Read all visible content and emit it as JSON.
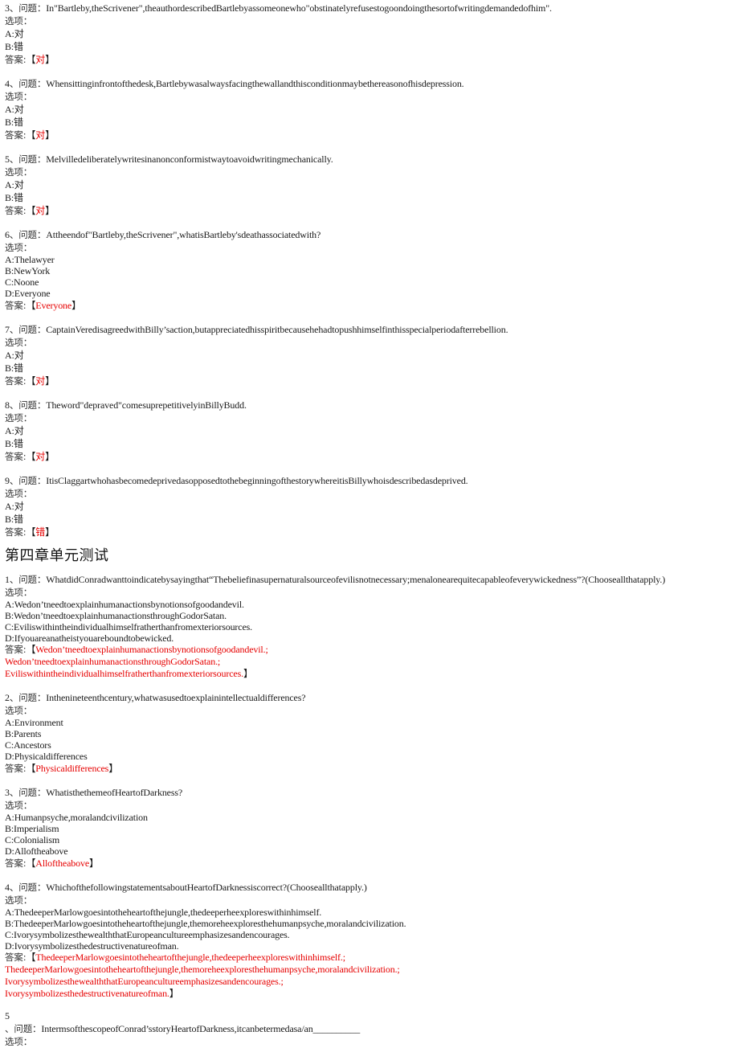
{
  "labels": {
    "question_prefix": "、问题：",
    "options_label": "选项：",
    "answer_label": "答案:",
    "bracket_open": "【",
    "bracket_close": "】"
  },
  "part1": [
    {
      "number": "3",
      "question": "In\"Bartleby,theScrivener\",theauthordescribedBartlebyassomeonewho\"obstinatelyrefusestogoondoingthesortofwritingdemandedofhim\".",
      "options": [
        "A:对",
        "B:错"
      ],
      "answer": "对"
    },
    {
      "number": "4",
      "question": "Whensittinginfrontofthedesk,Bartlebywasalwaysfacingthewallandthisconditionmaybethereasonofhisdepression.",
      "options": [
        "A:对",
        "B:错"
      ],
      "answer": "对"
    },
    {
      "number": "5",
      "question": "Melvilledeliberatelywritesinanonconformistwaytoavoidwritingmechanically.",
      "options": [
        "A:对",
        "B:错"
      ],
      "answer": "对"
    },
    {
      "number": "6",
      "question": "Attheendof\"Bartleby,theScrivener\",whatisBartleby'sdeathassociatedwith?",
      "options": [
        "A:Thelawyer",
        "B:NewYork",
        "C:Noone",
        "D:Everyone"
      ],
      "answer": "Everyone"
    },
    {
      "number": "7",
      "question": "CaptainVeredisagreedwithBilly’saction,butappreciatedhisspiritbecausehehadtopushhimselfinthisspecialperiodafterrebellion.",
      "options": [
        "A:对",
        "B:错"
      ],
      "answer": "对"
    },
    {
      "number": "8",
      "question": "Theword\"depraved\"comesuprepetitivelyinBillyBudd.",
      "options": [
        "A:对",
        "B:错"
      ],
      "answer": "对"
    },
    {
      "number": "9",
      "question": "ItisClaggartwhohasbecomedeprivedasopposedtothebeginningofthestorywhereitisBillywhoisdescribedasdeprived.",
      "options": [
        "A:对",
        "B:错"
      ],
      "answer": "错"
    }
  ],
  "section_title": "第四章单元测试",
  "part2": [
    {
      "number": "1",
      "question": "WhatdidConradwanttoindicatebysayingthat“Thebeliefinasupernaturalsourceofevilisnotnecessary;menalonearequitecapableofeverywickedness”?(Chooseallthatapply.)",
      "options": [
        "A:Wedon’tneedtoexplainhumanactionsbynotionsofgoodandevil.",
        "B:Wedon’tneedtoexplainhumanactionsthroughGodorSatan.",
        "C:Eviliswithintheindividualhimselfratherthanfromexteriorsources.",
        "D:Ifyouareanatheistyouareboundtobewicked."
      ],
      "answer_lines": [
        "Wedon’tneedtoexplainhumanactionsbynotionsofgoodandevil.;",
        "Wedon’tneedtoexplainhumanactionsthroughGodorSatan.;",
        "Eviliswithintheindividualhimselfratherthanfromexteriorsources."
      ]
    },
    {
      "number": "2",
      "question": "Inthenineteenthcentury,whatwasusedtoexplainintellectualdifferences?",
      "options": [
        "A:Environment",
        "B:Parents",
        "C:Ancestors",
        "D:Physicaldifferences"
      ],
      "answer": "Physicaldifferences"
    },
    {
      "number": "3",
      "question": "WhatisthethemeofHeartofDarkness?",
      "options": [
        "A:Humanpsyche,moralandcivilization",
        "B:Imperialism",
        "C:Colonialism",
        "D:Alloftheabove"
      ],
      "answer": "Alloftheabove"
    },
    {
      "number": "4",
      "question": "WhichofthefollowingstatementsaboutHeartofDarknessiscorrect?(Chooseallthatapply.)",
      "options": [
        "A:ThedeeperMarlowgoesintotheheartofthejungle,thedeeperheexploreswithinhimself.",
        "B:ThedeeperMarlowgoesintotheheartofthejungle,themoreheexploresthehumanpsyche,moralandcivilization.",
        "C:IvorysymbolizesthewealththatEuropeancultureemphasizesandencourages.",
        "D:Ivorysymbolizesthedestructivenatureofman."
      ],
      "answer_lines": [
        "ThedeeperMarlowgoesintotheheartofthejungle,thedeeperheexploreswithinhimself.;",
        "ThedeeperMarlowgoesintotheheartofthejungle,themoreheexploresthehumanpsyche,moralandcivilization.;",
        "IvorysymbolizesthewealththatEuropeancultureemphasizesandencourages.;",
        "Ivorysymbolizesthedestructivenatureofman."
      ]
    },
    {
      "number": "5",
      "question": "IntermsofthescopeofConrad’sstoryHeartofDarkness,itcanbetermedasa/an__________"
    }
  ]
}
